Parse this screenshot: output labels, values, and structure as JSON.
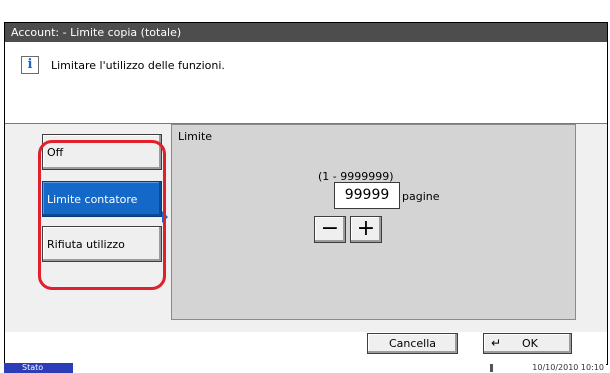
{
  "window": {
    "title": "Account:  - Limite copia (totale)"
  },
  "info": {
    "icon": "info-icon",
    "message": "Limitare l'utilizzo delle funzioni."
  },
  "modes": [
    {
      "label": "Off",
      "selected": false
    },
    {
      "label": "Limite contatore",
      "selected": true
    },
    {
      "label": "Rifiuta utilizzo",
      "selected": false
    }
  ],
  "limit_panel": {
    "title": "Limite",
    "range": "(1 - 9999999)",
    "value": "99999",
    "unit": "pagine",
    "minus_symbol": "−",
    "plus_symbol": "+"
  },
  "footer": {
    "cancel_label": "Cancella",
    "ok_label": "OK",
    "ok_icon": "enter-return-icon"
  },
  "status_bar": {
    "status_label": "Stato",
    "datetime": "10/10/2010  10:10"
  },
  "colors": {
    "title_bar": "#4d4d4d",
    "selected_button": "#1468c8",
    "highlight_frame": "#e0202a",
    "status_tag": "#2d3db8"
  }
}
